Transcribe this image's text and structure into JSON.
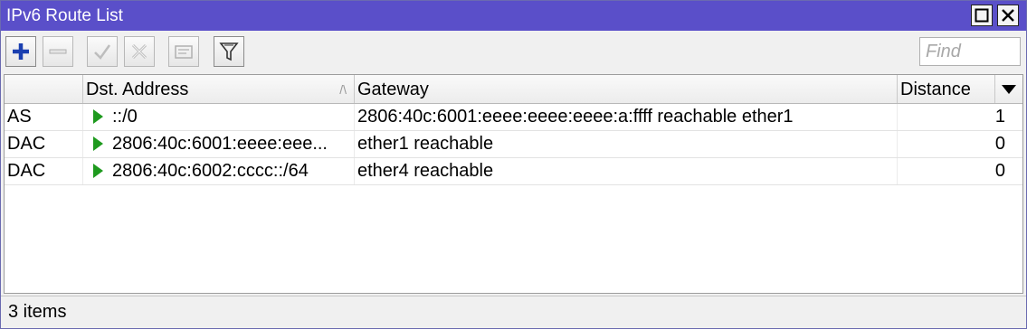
{
  "window": {
    "title": "IPv6 Route List"
  },
  "titlebar_buttons": [
    {
      "name": "maximize-button",
      "icon": "maximize-icon"
    },
    {
      "name": "close-button",
      "icon": "close-icon"
    }
  ],
  "toolbar": {
    "buttons": [
      {
        "name": "add-button",
        "icon": "plus-icon",
        "enabled": true
      },
      {
        "name": "remove-button",
        "icon": "minus-icon",
        "enabled": false
      },
      {
        "name": "enable-button",
        "icon": "check-icon",
        "enabled": false
      },
      {
        "name": "disable-button",
        "icon": "x-icon",
        "enabled": false
      },
      {
        "name": "comment-button",
        "icon": "note-icon",
        "enabled": false
      },
      {
        "name": "filter-button",
        "icon": "funnel-icon",
        "enabled": true
      }
    ],
    "find_placeholder": "Find"
  },
  "table": {
    "columns": [
      "",
      "Dst. Address",
      "Gateway",
      "Distance"
    ],
    "sort_indicator": "/\\",
    "rows": [
      {
        "flags": "AS",
        "dst": "::/0",
        "gateway": "2806:40c:6001:eeee:eeee:eeee:a:ffff reachable ether1",
        "distance": "1"
      },
      {
        "flags": "DAC",
        "dst": "2806:40c:6001:eeee:eee...",
        "gateway": "ether1 reachable",
        "distance": "0"
      },
      {
        "flags": "DAC",
        "dst": "2806:40c:6002:cccc::/64",
        "gateway": "ether4 reachable",
        "distance": "0"
      }
    ]
  },
  "status": {
    "items_count": "3 items"
  },
  "colors": {
    "titlebar": "#5a4fc9",
    "add_icon": "#1a3fb0",
    "active_route_icon": "#1e9a1e"
  }
}
